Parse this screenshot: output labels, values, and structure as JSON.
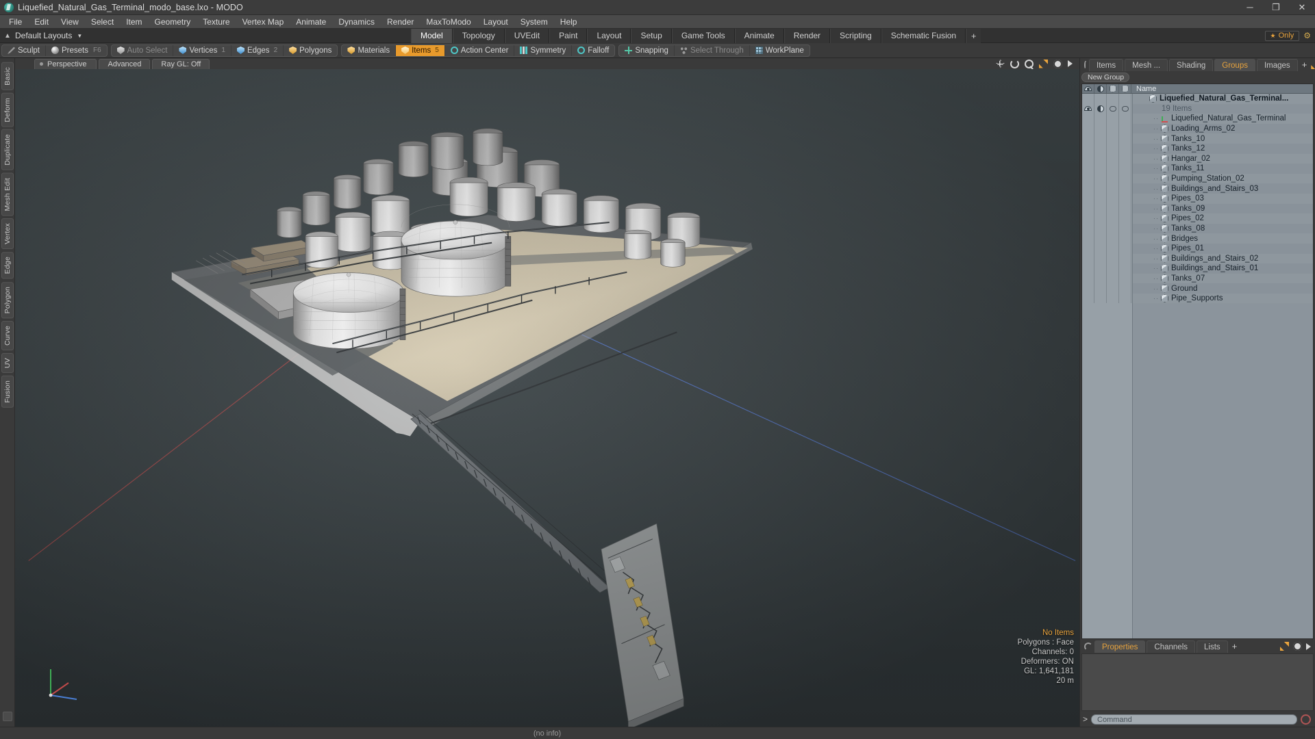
{
  "window": {
    "title": "Liquefied_Natural_Gas_Terminal_modo_base.lxo - MODO",
    "logo_icon": "modo-logo-icon",
    "minimize_label": "─",
    "maximize_label": "❐",
    "close_label": "✕"
  },
  "menubar": {
    "items": [
      {
        "label": "File"
      },
      {
        "label": "Edit"
      },
      {
        "label": "View"
      },
      {
        "label": "Select"
      },
      {
        "label": "Item"
      },
      {
        "label": "Geometry"
      },
      {
        "label": "Texture"
      },
      {
        "label": "Vertex Map"
      },
      {
        "label": "Animate"
      },
      {
        "label": "Dynamics"
      },
      {
        "label": "Render"
      },
      {
        "label": "MaxToModo"
      },
      {
        "label": "Layout"
      },
      {
        "label": "System"
      },
      {
        "label": "Help"
      }
    ]
  },
  "layout_row": {
    "up_arrow_icon": "arrow-up-icon",
    "preset_label": "Default Layouts",
    "caret_icon": "chevron-down-icon",
    "tabs": [
      {
        "label": "Model",
        "active": true
      },
      {
        "label": "Topology",
        "active": false
      },
      {
        "label": "UVEdit",
        "active": false
      },
      {
        "label": "Paint",
        "active": false
      },
      {
        "label": "Layout",
        "active": false
      },
      {
        "label": "Setup",
        "active": false
      },
      {
        "label": "Game Tools",
        "active": false
      },
      {
        "label": "Animate",
        "active": false
      },
      {
        "label": "Render",
        "active": false
      },
      {
        "label": "Scripting",
        "active": false
      },
      {
        "label": "Schematic Fusion",
        "active": false
      }
    ],
    "add_tab_label": "+",
    "only_star_icon": "star-icon",
    "only_label": "Only",
    "gear_icon": "gear-icon"
  },
  "mode_toolbar": {
    "groups": [
      {
        "buttons": [
          {
            "label": "Sculpt",
            "icon": "pen-icon",
            "state": "normal",
            "shortcut": ""
          },
          {
            "label": "Presets",
            "icon": "sphere-icon",
            "state": "normal",
            "shortcut": "F6"
          }
        ]
      },
      {
        "buttons": [
          {
            "label": "Auto Select",
            "icon": "shield-grey-icon",
            "state": "dim",
            "count": ""
          },
          {
            "label": "Vertices",
            "icon": "shield-blue-icon",
            "state": "normal",
            "count": "1"
          },
          {
            "label": "Edges",
            "icon": "shield-blue-icon",
            "state": "normal",
            "count": "2"
          },
          {
            "label": "Polygons",
            "icon": "shield-gold-icon",
            "state": "normal",
            "count": ""
          }
        ]
      },
      {
        "buttons": [
          {
            "label": "Materials",
            "icon": "shield-gold-icon",
            "state": "normal",
            "count": ""
          },
          {
            "label": "Items",
            "icon": "shield-selected-icon",
            "state": "active",
            "count": "5"
          },
          {
            "label": "Action Center",
            "icon": "ring-icon",
            "state": "normal",
            "count": ""
          },
          {
            "label": "Symmetry",
            "icon": "bars-icon",
            "state": "normal",
            "count": ""
          },
          {
            "label": "Falloff",
            "icon": "ring-icon",
            "state": "normal",
            "count": ""
          }
        ]
      },
      {
        "buttons": [
          {
            "label": "Snapping",
            "icon": "cross-icon",
            "state": "normal",
            "count": ""
          },
          {
            "label": "Select Through",
            "icon": "dots-icon",
            "state": "dim",
            "count": ""
          },
          {
            "label": "WorkPlane",
            "icon": "grid-icon",
            "state": "normal",
            "count": ""
          }
        ]
      }
    ]
  },
  "left_rail": {
    "tabs": [
      "Basic",
      "Deform",
      "Duplicate",
      "Mesh Edit",
      "Vertex",
      "Edge",
      "Polygon",
      "Curve",
      "UV",
      "Fusion"
    ]
  },
  "viewport": {
    "tabs": [
      {
        "label": "Perspective"
      },
      {
        "label": "Advanced"
      },
      {
        "label": "Ray GL: Off"
      }
    ],
    "icons": [
      "move-icon",
      "rotate-icon",
      "search-icon",
      "expand-icon",
      "gear-icon",
      "arrow-right-icon"
    ],
    "stats": {
      "selection": "No Items",
      "polygons": "Polygons : Face",
      "channels": "Channels: 0",
      "deformers": "Deformers: ON",
      "gl": "GL: 1,641,181",
      "grid": "20 m"
    },
    "gizmo_axes": [
      "Y",
      "X",
      "Z"
    ]
  },
  "right_panel": {
    "tabs": [
      {
        "label": "Items",
        "active": false
      },
      {
        "label": "Mesh ...",
        "active": false
      },
      {
        "label": "Shading",
        "active": false
      },
      {
        "label": "Groups",
        "active": true
      },
      {
        "label": "Images",
        "active": false
      }
    ],
    "add_tab_label": "+",
    "expand_icon": "expand-icon",
    "more_icon": "arrow-right-icon",
    "new_group_button": "New Group",
    "list": {
      "columns": [
        {
          "icon": "eye-icon",
          "name": "visibility"
        },
        {
          "icon": "half-circle-icon",
          "name": "shading"
        },
        {
          "icon": "hex-icon",
          "name": "render"
        },
        {
          "icon": "hex-icon",
          "name": "lock"
        },
        {
          "label": "Name"
        }
      ],
      "rows": [
        {
          "label": "Liquefied_Natural_Gas_Terminal...",
          "type": "group-head",
          "icon": "hex-item-icon"
        },
        {
          "label": "19 Items",
          "type": "sub-count",
          "icon": ""
        },
        {
          "label": "Liquefied_Natural_Gas_Terminal",
          "type": "child",
          "icon": "axis-locator-icon"
        },
        {
          "label": "Loading_Arms_02",
          "type": "child",
          "icon": "hex-item-icon"
        },
        {
          "label": "Tanks_10",
          "type": "child",
          "icon": "hex-item-icon"
        },
        {
          "label": "Tanks_12",
          "type": "child",
          "icon": "hex-item-icon"
        },
        {
          "label": "Hangar_02",
          "type": "child",
          "icon": "hex-item-icon"
        },
        {
          "label": "Tanks_11",
          "type": "child",
          "icon": "hex-item-icon"
        },
        {
          "label": "Pumping_Station_02",
          "type": "child",
          "icon": "hex-item-icon"
        },
        {
          "label": "Buildings_and_Stairs_03",
          "type": "child",
          "icon": "hex-item-icon"
        },
        {
          "label": "Pipes_03",
          "type": "child",
          "icon": "hex-item-icon"
        },
        {
          "label": "Tanks_09",
          "type": "child",
          "icon": "hex-item-icon"
        },
        {
          "label": "Pipes_02",
          "type": "child",
          "icon": "hex-item-icon"
        },
        {
          "label": "Tanks_08",
          "type": "child",
          "icon": "hex-item-icon"
        },
        {
          "label": "Bridges",
          "type": "child",
          "icon": "hex-item-icon"
        },
        {
          "label": "Pipes_01",
          "type": "child",
          "icon": "hex-item-icon"
        },
        {
          "label": "Buildings_and_Stairs_02",
          "type": "child",
          "icon": "hex-item-icon"
        },
        {
          "label": "Buildings_and_Stairs_01",
          "type": "child",
          "icon": "hex-item-icon"
        },
        {
          "label": "Tanks_07",
          "type": "child",
          "icon": "hex-item-icon"
        },
        {
          "label": "Ground",
          "type": "child",
          "icon": "hex-item-icon"
        },
        {
          "label": "Pipe_Supports",
          "type": "child",
          "icon": "hex-item-icon"
        }
      ]
    },
    "bottom": {
      "tabs": [
        {
          "label": "Properties",
          "active": true
        },
        {
          "label": "Channels",
          "active": false
        },
        {
          "label": "Lists",
          "active": false
        }
      ],
      "add_tab_label": "+"
    }
  },
  "command_bar": {
    "prompt": "&gt;",
    "placeholder": "Command",
    "record_icon": "record-icon"
  },
  "status_bar": {
    "info": "(no info)"
  },
  "colors": {
    "accent": "#e89a2c",
    "panel": "#3a3a3a",
    "list_bg": "#8b949c",
    "axis_x": "#c44848",
    "axis_z": "#5478d6"
  }
}
